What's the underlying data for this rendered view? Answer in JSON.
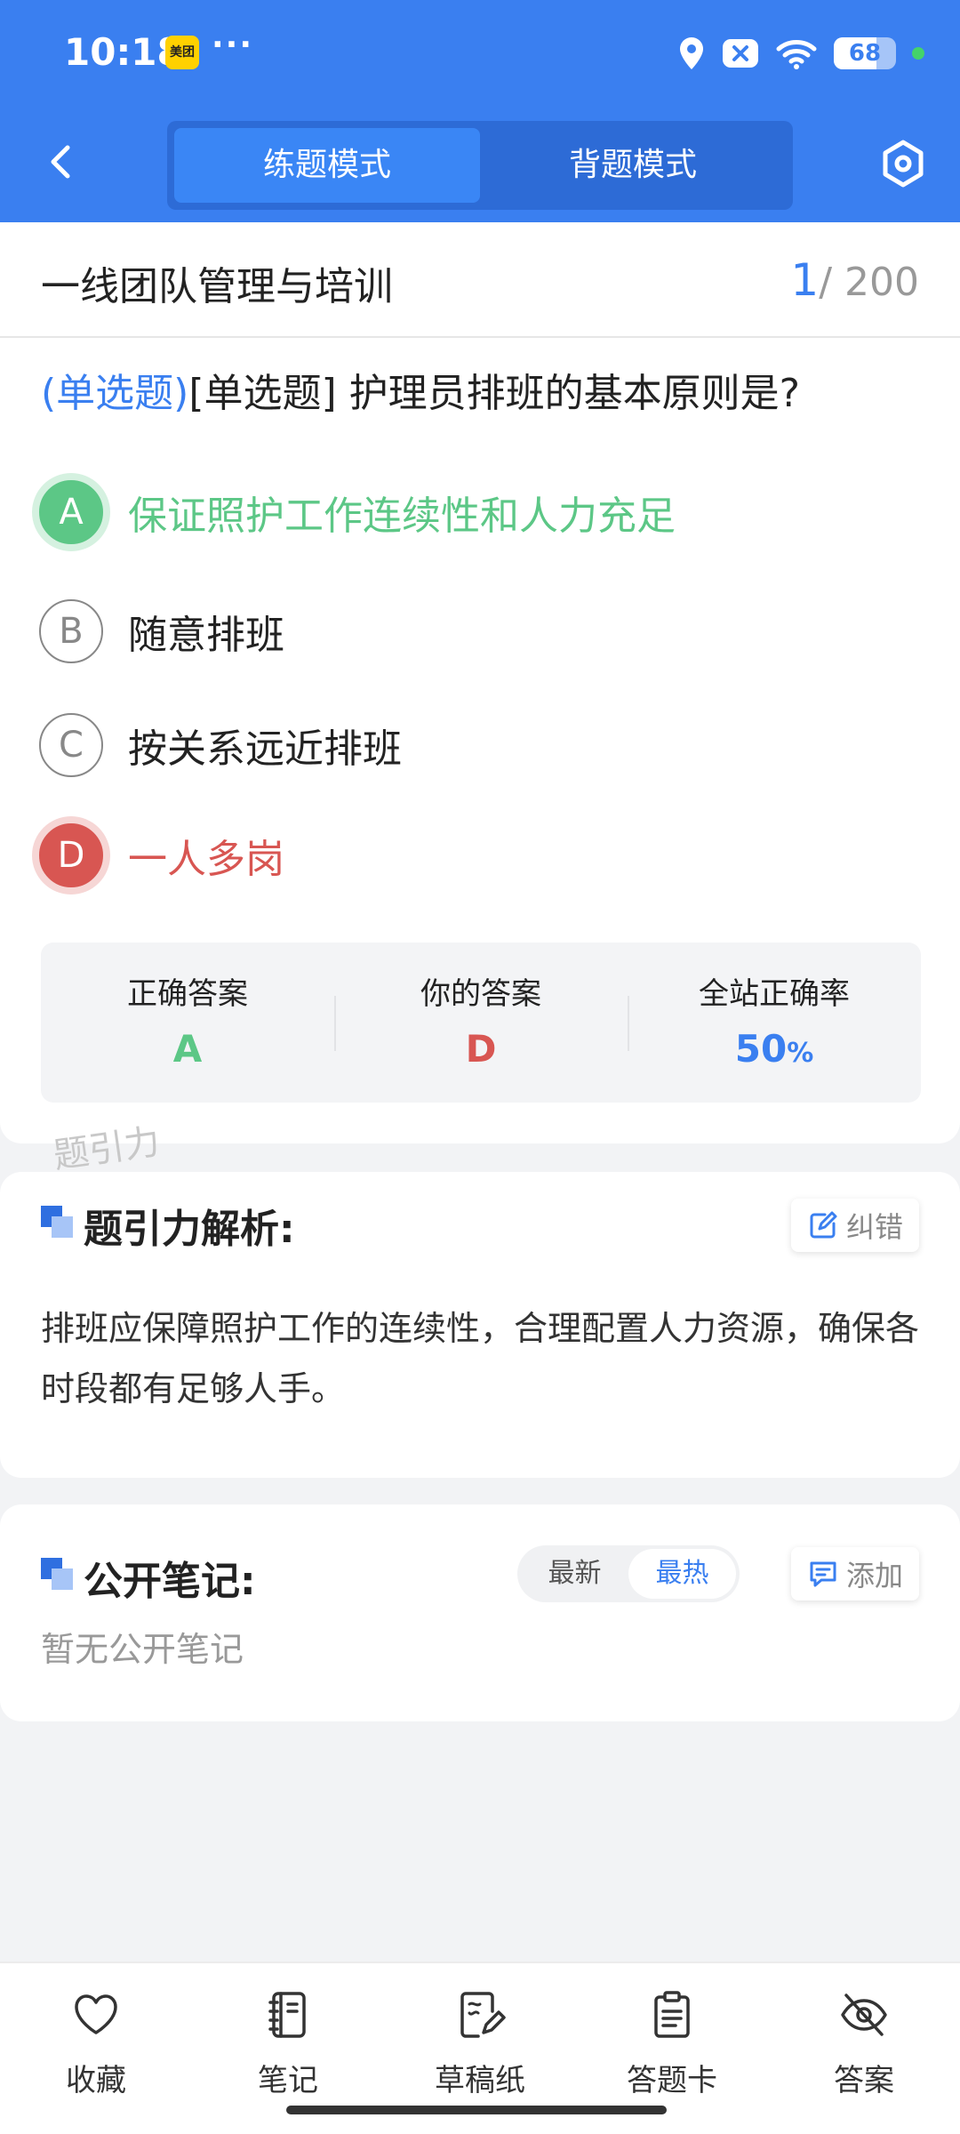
{
  "status_bar": {
    "time": "10:18",
    "app_badge": "美团",
    "more": "···",
    "battery": "68"
  },
  "nav": {
    "tabs": [
      {
        "label": "练题模式",
        "active": true
      },
      {
        "label": "背题模式",
        "active": false
      }
    ]
  },
  "question": {
    "chapter": "一线团队管理与培训",
    "current": "1",
    "total": "/ 200",
    "type_tag": "(单选题)",
    "text": "[单选题] 护理员排班的基本原则是?",
    "options": [
      {
        "letter": "A",
        "text": "保证照护工作连续性和人力充足",
        "state": "correct"
      },
      {
        "letter": "B",
        "text": "随意排班",
        "state": "normal"
      },
      {
        "letter": "C",
        "text": "按关系远近排班",
        "state": "normal"
      },
      {
        "letter": "D",
        "text": "一人多岗",
        "state": "wrong"
      }
    ]
  },
  "stats": {
    "correct_label": "正确答案",
    "correct_value": "A",
    "yours_label": "你的答案",
    "yours_value": "D",
    "rate_label": "全站正确率",
    "rate_value": "50",
    "rate_unit": "%"
  },
  "watermark": "题引力",
  "analysis": {
    "title": "题引力解析:",
    "report_label": "纠错",
    "text": "排班应保障照护工作的连续性，合理配置人力资源，确保各时段都有足够人手。"
  },
  "notes": {
    "title": "公开笔记:",
    "sort_latest": "最新",
    "sort_hot": "最热",
    "add_label": "添加",
    "empty": "暂无公开笔记"
  },
  "toolbar": {
    "items": [
      {
        "label": "收藏",
        "icon": "heart-icon"
      },
      {
        "label": "笔记",
        "icon": "notebook-icon"
      },
      {
        "label": "草稿纸",
        "icon": "draft-icon"
      },
      {
        "label": "答题卡",
        "icon": "answer-card-icon"
      },
      {
        "label": "答案",
        "icon": "eye-off-icon"
      }
    ]
  },
  "colors": {
    "primary": "#3a7ff0",
    "correct": "#5cc786",
    "wrong": "#d85652"
  }
}
